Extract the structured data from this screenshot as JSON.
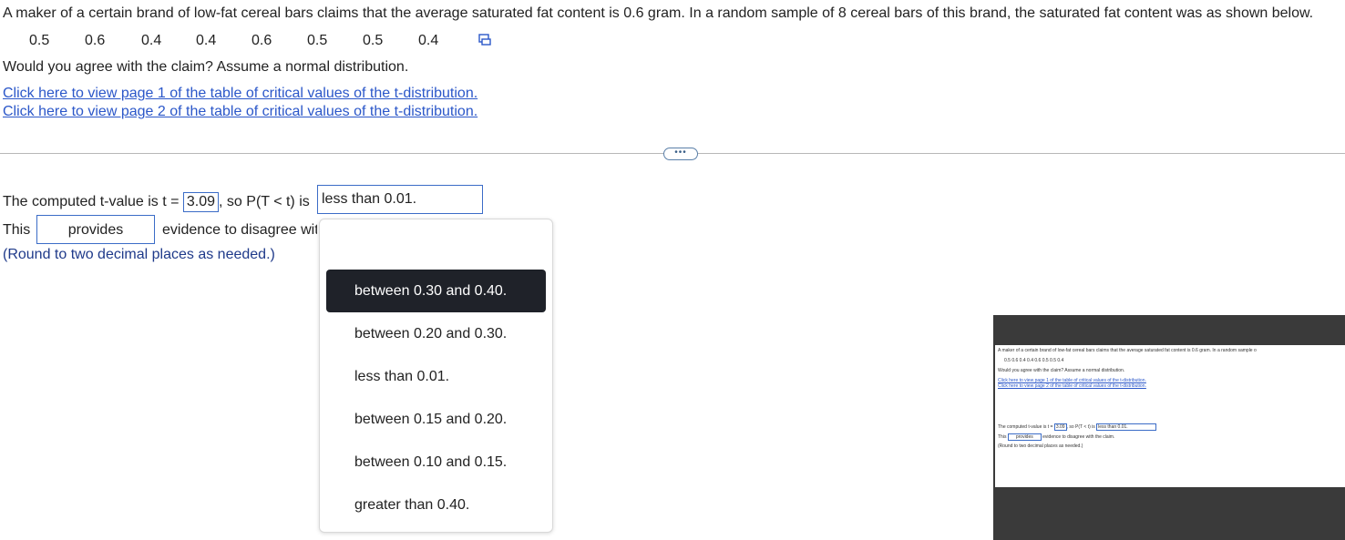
{
  "question": {
    "text": "A maker of a certain brand of low-fat cereal bars claims that the average saturated fat content is 0.6 gram. In a random sample of 8 cereal bars of this brand, the saturated fat content was as shown below.",
    "data_values": [
      "0.5",
      "0.6",
      "0.4",
      "0.4",
      "0.6",
      "0.5",
      "0.5",
      "0.4"
    ],
    "agree_prompt": "Would you agree with the claim? Assume a normal distribution.",
    "link1": "Click here to view page 1 of the table of critical values of the t-distribution.",
    "link2": "Click here to view page 2 of the table of critical values of the t-distribution."
  },
  "divider_pill": "•••",
  "answer": {
    "t_prefix": "The computed t-value is t =",
    "t_value": "3.09",
    "p_prefix": ", so P(T < t) is",
    "p_value": "less than 0.01.",
    "this_label": "This",
    "provides_value": "provides",
    "evidence_text": "evidence to disagree with the claim.",
    "round_note": "(Round to two decimal places as needed.)"
  },
  "dropdown": {
    "options": [
      "between 0.30 and 0.40.",
      "between 0.20 and 0.30.",
      "less than 0.01.",
      "between 0.15 and 0.20.",
      "between 0.10 and 0.15.",
      "greater than 0.40."
    ],
    "selected_index": 0
  },
  "thumbnail": {
    "text": "A maker of a certain brand of low-fat cereal bars claims that the average saturated fat content is 0.6 gram. In a random sample o",
    "values": "0.5     0.6     0.4     0.4     0.6     0.5     0.5     0.4",
    "agree": "Would you agree with the claim? Assume a normal distribution.",
    "link1": "Click here to view page 1 of the table of critical values of the t-distribution.",
    "link2": "Click here to view page 2 of the table of critical values of the t-distribution.",
    "line1_prefix": "The computed t-value is t =",
    "t_value": "3.09",
    "line1_mid": ", so P(T < t) is",
    "p_value": "less than 0.01.",
    "this_label": "This",
    "provides": "provides",
    "evidence": "evidence to disagree with the claim.",
    "round": "(Round to two decimal places as needed.)"
  },
  "colors": {
    "accent": "#3b6cc7",
    "selected_bg": "#1f2229",
    "link": "#2b57c9"
  }
}
